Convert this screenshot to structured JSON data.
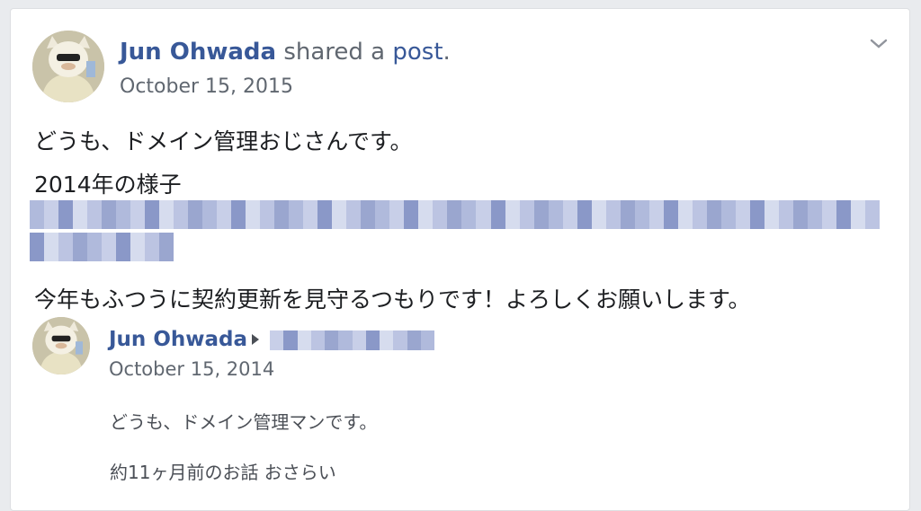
{
  "post": {
    "author": "Jun Ohwada",
    "action_text": " shared a ",
    "post_link": "post",
    "period": ".",
    "date": "October 15, 2015",
    "lines": [
      "どうも、ドメイン管理おじさんです。",
      "2014年の様子",
      "今年もふつうに契約更新を見守るつもりです！よろしくお願いします。"
    ]
  },
  "shared": {
    "author": "Jun Ohwada",
    "date": "October 15, 2014",
    "lines": [
      "どうも、ドメイン管理マンです。",
      "約11ヶ月前のお話 おさらい"
    ]
  },
  "icons": {
    "menu": "chevron-down-icon",
    "arrow": "caret-right-icon"
  },
  "colors": {
    "link": "#385898",
    "meta": "#606770",
    "text": "#1c1e21",
    "blur": "#9aa6cf"
  }
}
